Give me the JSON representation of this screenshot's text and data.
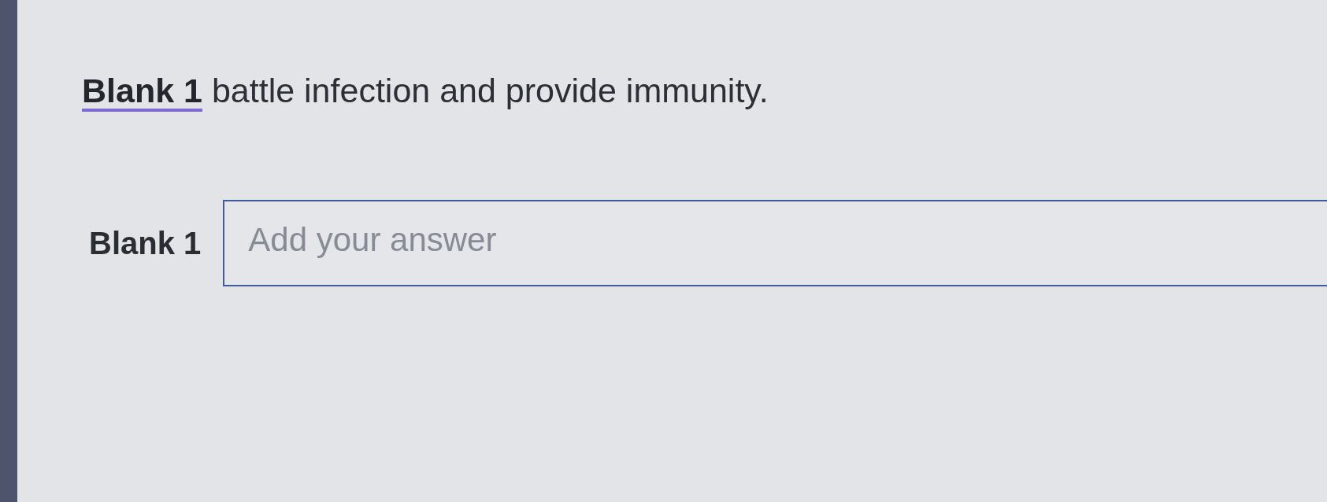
{
  "question": {
    "blank": "Blank 1",
    "text": "battle infection and provide immunity."
  },
  "answers": [
    {
      "label": "Blank 1",
      "placeholder": "Add your answer"
    }
  ]
}
